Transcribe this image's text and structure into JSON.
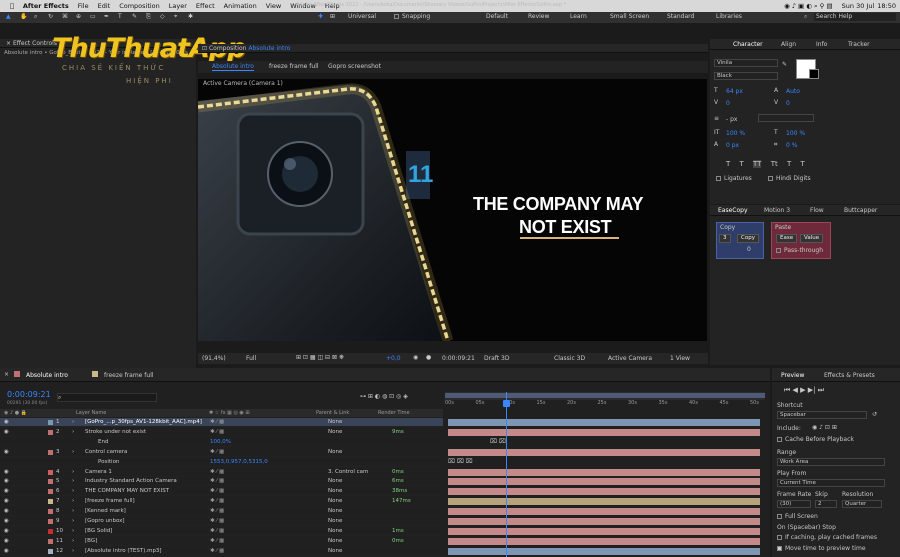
{
  "menubar": {
    "app": "After Effects",
    "items": [
      "File",
      "Edit",
      "Composition",
      "Layer",
      "Effect",
      "Animation",
      "View",
      "Window",
      "Help"
    ],
    "date": "Sun 30 Jul",
    "time": "18:50"
  },
  "toolbar": {
    "title": "Adobe After Effects 2022 - /Users/koka/Documents/Shorsary Videos/GoPro/Projects/After Effects/GoPro.aep *",
    "universal": "Universal",
    "snapping": "Snapping",
    "workspaces": [
      "Default",
      "Review",
      "Learn",
      "Small Screen",
      "Standard",
      "Libraries"
    ],
    "search": "Search Help"
  },
  "left_panel": {
    "tab": "Effect Controls",
    "path": "Absolute intro • GoPro_Best of 2022 - Year in Review [1440p_30fps_AV1-128kbit_AAC].mp4"
  },
  "watermark": {
    "title": "ThuThuatApp",
    "sub1": "CHIA SẺ KIẾN THỨC",
    "sub2": "HIỆN PHI"
  },
  "comp_panel": {
    "tab": "Composition",
    "tab_name": "Absolute intro",
    "view_tabs": [
      "Absolute intro",
      "freeze frame full",
      "Gopro screenshot"
    ],
    "camera": "Active Camera (Camera 1)",
    "headline1": "THE COMPANY MAY",
    "headline2": "NOT EXIST"
  },
  "viewer_bar": {
    "zoom": "(91,4%)",
    "quality": "Full",
    "exposure": "+0,0",
    "time": "0:00:09:21",
    "renderer": "Draft 3D",
    "mode": "Classic 3D",
    "camera": "Active Camera",
    "views": "1 View"
  },
  "character": {
    "tabs": [
      "Character",
      "Align",
      "Info",
      "Tracker"
    ],
    "font": "Vinila",
    "style": "Black",
    "size": "64 px",
    "leading": "Auto",
    "kern": "0",
    "track": "0",
    "units": "- px",
    "vscale": "100 %",
    "hscale": "100 %",
    "baseline": "0 px",
    "tsume": "0 %",
    "ligatures": "Ligatures",
    "hindi": "Hindi Digits",
    "style_buttons": [
      "T",
      "T",
      "TT",
      "Tt",
      "T",
      "T"
    ]
  },
  "easecopy": {
    "tabs": [
      "EaseCopy",
      "Motion 3",
      "Flow",
      "Buttcapper"
    ],
    "copy_title": "Copy",
    "copy_btn": "Copy",
    "copy_val": "0",
    "paste_title": "Paste",
    "ease_btn": "Ease",
    "value_btn": "Value",
    "pass_through": "Pass-through"
  },
  "timeline": {
    "tabs": [
      "Absolute intro",
      "freeze frame full"
    ],
    "timecode": "0:00:09:21",
    "fps": "00291 (30.00 fps)",
    "columns": {
      "layer_name": "Layer Name",
      "parent": "Parent & Link",
      "render": "Render Time"
    },
    "ruler": [
      "00s",
      "05s",
      "10s",
      "15s",
      "20s",
      "25s",
      "30s",
      "35s",
      "40s",
      "45s",
      "50s"
    ],
    "layers": [
      {
        "num": "1",
        "name": "[GoPro_...p_30fps_AV1-128kbit_AAC].mp4]",
        "parent": "None",
        "render": "",
        "sw": "#7a9ab0"
      },
      {
        "num": "2",
        "name": "Stroke under not exist",
        "parent": "None",
        "render": "9ms",
        "sw": "#c07070"
      },
      {
        "num": "",
        "name": "End",
        "parent": "",
        "render": "",
        "val": "100,0%",
        "sw": ""
      },
      {
        "num": "3",
        "name": "Control camera",
        "parent": "None",
        "render": "",
        "sw": "#c07070"
      },
      {
        "num": "",
        "name": "Position",
        "parent": "",
        "render": "",
        "val": "1553,0,957,0,5315,0",
        "sw": ""
      },
      {
        "num": "4",
        "name": "Camera 1",
        "parent": "3. Control cam",
        "render": "0ms",
        "sw": "#d06060"
      },
      {
        "num": "5",
        "name": "Industry Standard Action Camera",
        "parent": "None",
        "render": "6ms",
        "sw": "#c07070"
      },
      {
        "num": "6",
        "name": "THE COMPANY MAY NOT EXIST",
        "parent": "None",
        "render": "38ms",
        "sw": "#c07070"
      },
      {
        "num": "7",
        "name": "[freeze frame full]",
        "parent": "None",
        "render": "147ms",
        "sw": "#c8b88a"
      },
      {
        "num": "8",
        "name": "[Kenned mark]",
        "parent": "None",
        "render": "",
        "sw": "#c07070"
      },
      {
        "num": "9",
        "name": "[Gopro unbox]",
        "parent": "None",
        "render": "",
        "sw": "#c07070"
      },
      {
        "num": "10",
        "name": "[BG Solid]",
        "parent": "None",
        "render": "1ms",
        "sw": "#c03030"
      },
      {
        "num": "11",
        "name": "[BG]",
        "parent": "None",
        "render": "0ms",
        "sw": "#c07070"
      },
      {
        "num": "12",
        "name": "[Absolute intro (TEST).mp3]",
        "parent": "None",
        "render": "",
        "sw": "#9fb0c0"
      }
    ]
  },
  "preview": {
    "tabs": [
      "Preview",
      "Effects & Presets"
    ],
    "shortcut_label": "Shortcut",
    "shortcut": "Spacebar",
    "include": "Include:",
    "cache": "Cache Before Playback",
    "range_label": "Range",
    "range": "Work Area",
    "play_from_label": "Play From",
    "play_from": "Current Time",
    "frame_rate_label": "Frame Rate",
    "skip_label": "Skip",
    "resolution_label": "Resolution",
    "frame_rate": "(30)",
    "skip": "2",
    "resolution": "Quarter",
    "full_screen": "Full Screen",
    "stop_label": "On (Spacebar) Stop",
    "if_caching": "If caching, play cached frames",
    "move_time": "Move time to preview time"
  },
  "colors": {
    "accent": "#3a86ff",
    "rail": "#f0d890",
    "bar_pink": "#c48a8a",
    "bar_tan": "#b8a27c",
    "bar_blue": "#7e96b4"
  }
}
